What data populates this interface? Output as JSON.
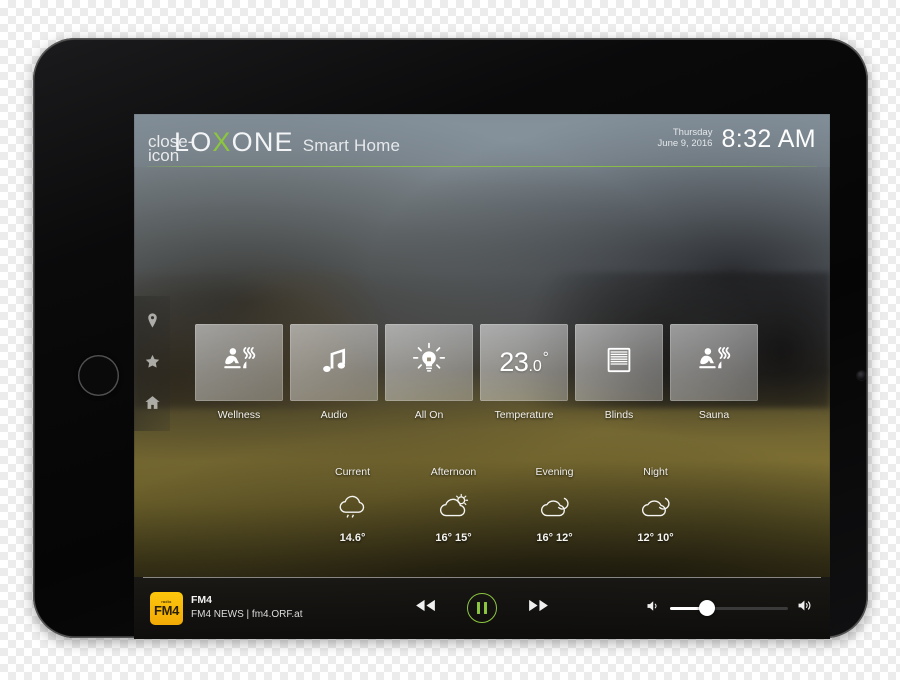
{
  "header": {
    "close_icon": "close-icon",
    "brand_pre": "LO",
    "brand_x": "X",
    "brand_post": "ONE",
    "brand_sub": "Smart Home",
    "weekday": "Thursday",
    "date": "June 9, 2016",
    "time": "8:32 AM",
    "accent_green": "#8cc63e"
  },
  "rail": {
    "items": [
      {
        "icon": "location-pin-icon"
      },
      {
        "icon": "star-icon"
      },
      {
        "icon": "home-icon"
      }
    ]
  },
  "tiles": [
    {
      "label": "Wellness",
      "icon": "sauna-person-icon"
    },
    {
      "label": "Audio",
      "icon": "music-note-icon"
    },
    {
      "label": "All On",
      "icon": "light-bulb-icon"
    },
    {
      "label": "Temperature",
      "icon": "temperature-value",
      "value_big": "23",
      "value_dec": ".0",
      "value_deg": "°"
    },
    {
      "label": "Blinds",
      "icon": "blinds-icon"
    },
    {
      "label": "Sauna",
      "icon": "sauna-person-icon"
    }
  ],
  "weather": [
    {
      "name": "Current",
      "icon": "cloud-rain-icon",
      "temp": "14.6°"
    },
    {
      "name": "Afternoon",
      "icon": "sun-cloud-icon",
      "temp": "16° 15°"
    },
    {
      "name": "Evening",
      "icon": "moon-cloud-icon",
      "temp": "16° 12°"
    },
    {
      "name": "Night",
      "icon": "moon-cloud-icon",
      "temp": "12° 10°"
    }
  ],
  "player": {
    "art_top": "radio",
    "art_main": "FM4",
    "station": "FM4",
    "now_playing": "FM4 NEWS | fm4.ORF.at",
    "prev_icon": "rewind-icon",
    "pause_icon": "pause-icon",
    "next_icon": "fast-forward-icon",
    "volume_low_icon": "volume-low-icon",
    "volume_high_icon": "volume-high-icon",
    "volume_percent": 31
  }
}
